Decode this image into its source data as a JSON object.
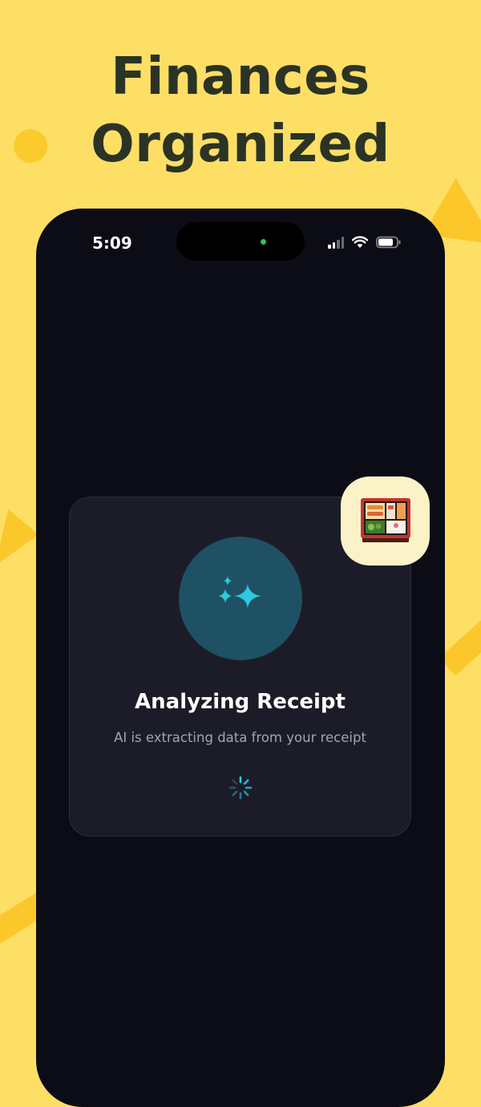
{
  "headline": {
    "line1": "Finances",
    "line2": "Organized"
  },
  "status_bar": {
    "time": "5:09"
  },
  "card": {
    "title": "Analyzing Receipt",
    "subtitle": "AI is extracting data from your receipt"
  },
  "icons": {
    "sparkle": "sparkles-icon",
    "spinner": "loading-spinner-icon",
    "food": "bento-box-icon",
    "wifi": "wifi-icon",
    "battery": "battery-icon",
    "signal": "cellular-signal-icon"
  },
  "colors": {
    "background": "#FDDF66",
    "headline": "#2B3324",
    "phone": "#0C0C17",
    "card": "#1C1C28",
    "accent": "#2CC9E0"
  }
}
